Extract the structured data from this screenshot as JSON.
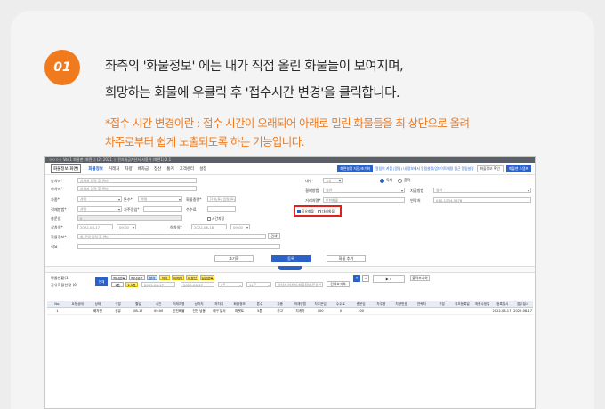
{
  "step": {
    "number": "01"
  },
  "instructions": {
    "line1": "좌측의 '화물정보' 에는 내가 직접 올린 화물들이 보여지며,",
    "line2": "희망하는 화물에 우클릭 후 '접수시간 변경'을 클릭합니다."
  },
  "note": {
    "line1": "*접수 시간 변경이란 : 접수 시간이 오래되어 아래로 밀린 화물들을 최 상단으로 올려",
    "line2": "차주로부터 쉽게 노출되도록 하는 기능입니다."
  },
  "app": {
    "title": "ㅇㅇㅇㅇ Ver.1  화물맨 (화면1) (2) 2021 ㅏ 전자세금계산서 사용가 (화면1) 2.1",
    "brand": "화물정보(화면)",
    "menu": [
      "화물정보",
      "거래처",
      "차량",
      "배차금",
      "정산",
      "통계",
      "고객센터",
      "설정"
    ],
    "top_blue": "화면설정 저장/초기화",
    "top_notice": "알림이 켜짐 (알림) 내 정보에서 알림설정/업데이트내용 접근 알림설정",
    "top_btn1": "화물정보 확인",
    "top_btn2": "화물맨 스탬프"
  },
  "form": {
    "shipper_label": "상차지*",
    "shipper_placeholder": "상차지 입력 후 엔터",
    "unloader_label": "하차지*",
    "unloader_placeholder": "하차지 입력 후 엔터",
    "vehicle_label": "차종*",
    "vehicle_value": "선택",
    "ton_label": "톤수*",
    "ton_value": "선택",
    "cargo_amount_label": "화물중량*",
    "cargo_amount_placeholder": "단위(톤) 입력(톤)",
    "loading_label": "적재방법*",
    "loading_value": "선택",
    "weight_label": "차주운임*",
    "fee_label": "수수료",
    "total_label": "총운임",
    "total_value": "0",
    "time_check": "시간지정",
    "date_label": "상차일*",
    "date_value": "2022-08-17",
    "time_value": "09:00",
    "unload_date_label": "하차일*",
    "unload_date_value": "2022-08-18",
    "unload_time_value": "09:00",
    "cargo_info_label": "화물정보*",
    "cargo_info_placeholder": "화 운영 입력 후 엔터",
    "cargo_info_btn": "검색",
    "memo_label": "적요",
    "pay_label": "대수",
    "pay_value": "1대",
    "radio_on": "독차",
    "radio_off": "혼적",
    "payment_method_label": "결제방법",
    "payment_method_value": "일반",
    "payment_type_label": "지급방법",
    "payment_type_value": "일반",
    "client_label": "거래처명*",
    "client_value": "인천화물",
    "contact_label": "연락처",
    "contact_value": "010-1234-5678",
    "check1": "공유화물",
    "check2": "대리화물",
    "reset_btn": "초기화",
    "register_btn": "등록",
    "add_btn": "화물 추가"
  },
  "list": {
    "title": "화물현황(1)",
    "sub": "공유화물현황 (0)",
    "tab_active": "전체",
    "tags": [
      "배차완료",
      "배차취소",
      "상차",
      "하차",
      "미배차",
      "미정산",
      "입금완료"
    ],
    "tag_row2": [
      "1톤",
      "2.5톤",
      "5톤",
      "11톤",
      "25톤"
    ],
    "date_from": "2022-08-17",
    "date_to": "2022-08-17",
    "search_placeholder": "상차지/하차지/화물정보/운송인",
    "search_btn": "검색초기화",
    "count": "4",
    "print_btn": "출력초기화",
    "headers": [
      "No.",
      "요청상태",
      "상태",
      "구분",
      "월일",
      "시간",
      "거래처명",
      "상차지",
      "하차지",
      "화물정보",
      "톤수",
      "차종",
      "적재방법",
      "차주운임",
      "수수료",
      "총운임",
      "차주명",
      "차량번호",
      "연락처",
      "구분",
      "최초등록일",
      "최종수정일",
      "등록일시",
      "접수일시"
    ],
    "row": [
      "1",
      "",
      "배차전",
      "공유",
      "08-17",
      "09:00",
      "인천화물",
      "인천 남동",
      "대구 달서",
      "파렛트",
      "5톤",
      "카고",
      "지게차",
      "100",
      "0",
      "100",
      "",
      "",
      "",
      "",
      "",
      "",
      "2022-08-17 10:38",
      "2022-08-17"
    ]
  }
}
